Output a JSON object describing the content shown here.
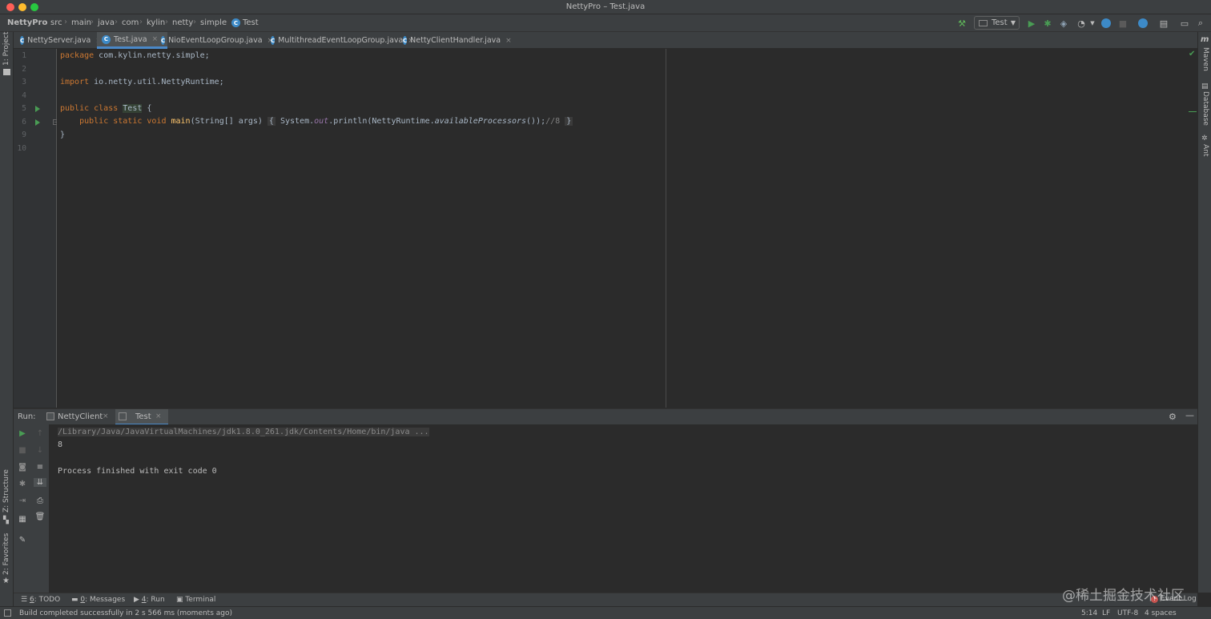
{
  "window": {
    "title": "NettyPro – Test.java"
  },
  "colors": {
    "close": "#ff5f57",
    "minimize": "#febc2e",
    "zoom": "#28c840",
    "accent": "#4a88c7",
    "run_green": "#499c54"
  },
  "breadcrumb": [
    "NettyPro",
    "src",
    "main",
    "java",
    "com",
    "kylin",
    "netty",
    "simple",
    "Test"
  ],
  "toolbar": {
    "run_config": "Test",
    "icons": [
      "hammer-icon",
      "run-icon",
      "debug-icon",
      "coverage-icon",
      "profile-icon",
      "sync-icon",
      "stop-icon",
      "git-icon",
      "project-structure-icon",
      "layout-icon",
      "search-icon"
    ]
  },
  "left_strip": {
    "project": "1: Project",
    "structure": "Z: Structure",
    "favorites": "2: Favorites"
  },
  "right_strip": {
    "maven": "Maven",
    "database": "Database",
    "ant": "Ant"
  },
  "tabs": [
    {
      "label": "NettyServer.java",
      "active": false
    },
    {
      "label": "Test.java",
      "active": true
    },
    {
      "label": "NioEventLoopGroup.java",
      "active": false
    },
    {
      "label": "MultithreadEventLoopGroup.java",
      "active": false
    },
    {
      "label": "NettyClientHandler.java",
      "active": false
    }
  ],
  "editor": {
    "line_numbers": [
      "1",
      "2",
      "3",
      "4",
      "5",
      "6",
      "9",
      "10"
    ],
    "lines": {
      "l1_kw": "package",
      "l1_rest": " com.kylin.netty.simple;",
      "l3_kw": "import",
      "l3_rest": " io.netty.util.NettyRuntime;",
      "l5_kw": "public class",
      "l5_name": "Test",
      "l5_rest": " {",
      "l6_kw": "public static void",
      "l6_fn": "main",
      "l6_args": "(String[] args) ",
      "l6_fold_open": "{",
      "l6_sys": " System.",
      "l6_out": "out",
      "l6_println": ".println(NettyRuntime.",
      "l6_method": "availableProcessors",
      "l6_end": "());",
      "l6_comment": "//8",
      "l6_fold_close": "}",
      "l9": "}"
    }
  },
  "run_panel": {
    "label": "Run:",
    "tabs": [
      "NettyClient",
      "Test"
    ],
    "output": [
      "/Library/Java/JavaVirtualMachines/jdk1.8.0_261.jdk/Contents/Home/bin/java ...",
      "8",
      "",
      "Process finished with exit code 0"
    ]
  },
  "bottom_tools": [
    {
      "num": "6",
      "label": ": TODO"
    },
    {
      "num": "0",
      "label": ": Messages"
    },
    {
      "num": "4",
      "label": ": Run"
    },
    {
      "num": "",
      "label": "Terminal"
    }
  ],
  "status": {
    "message": "Build completed successfully in 2 s 566 ms (moments ago)",
    "position": "5:14",
    "line_sep": "LF",
    "encoding": "UTF-8",
    "indent": "4 spaces",
    "event_log": "Event Log"
  },
  "watermark": "@稀土掘金技术社区"
}
